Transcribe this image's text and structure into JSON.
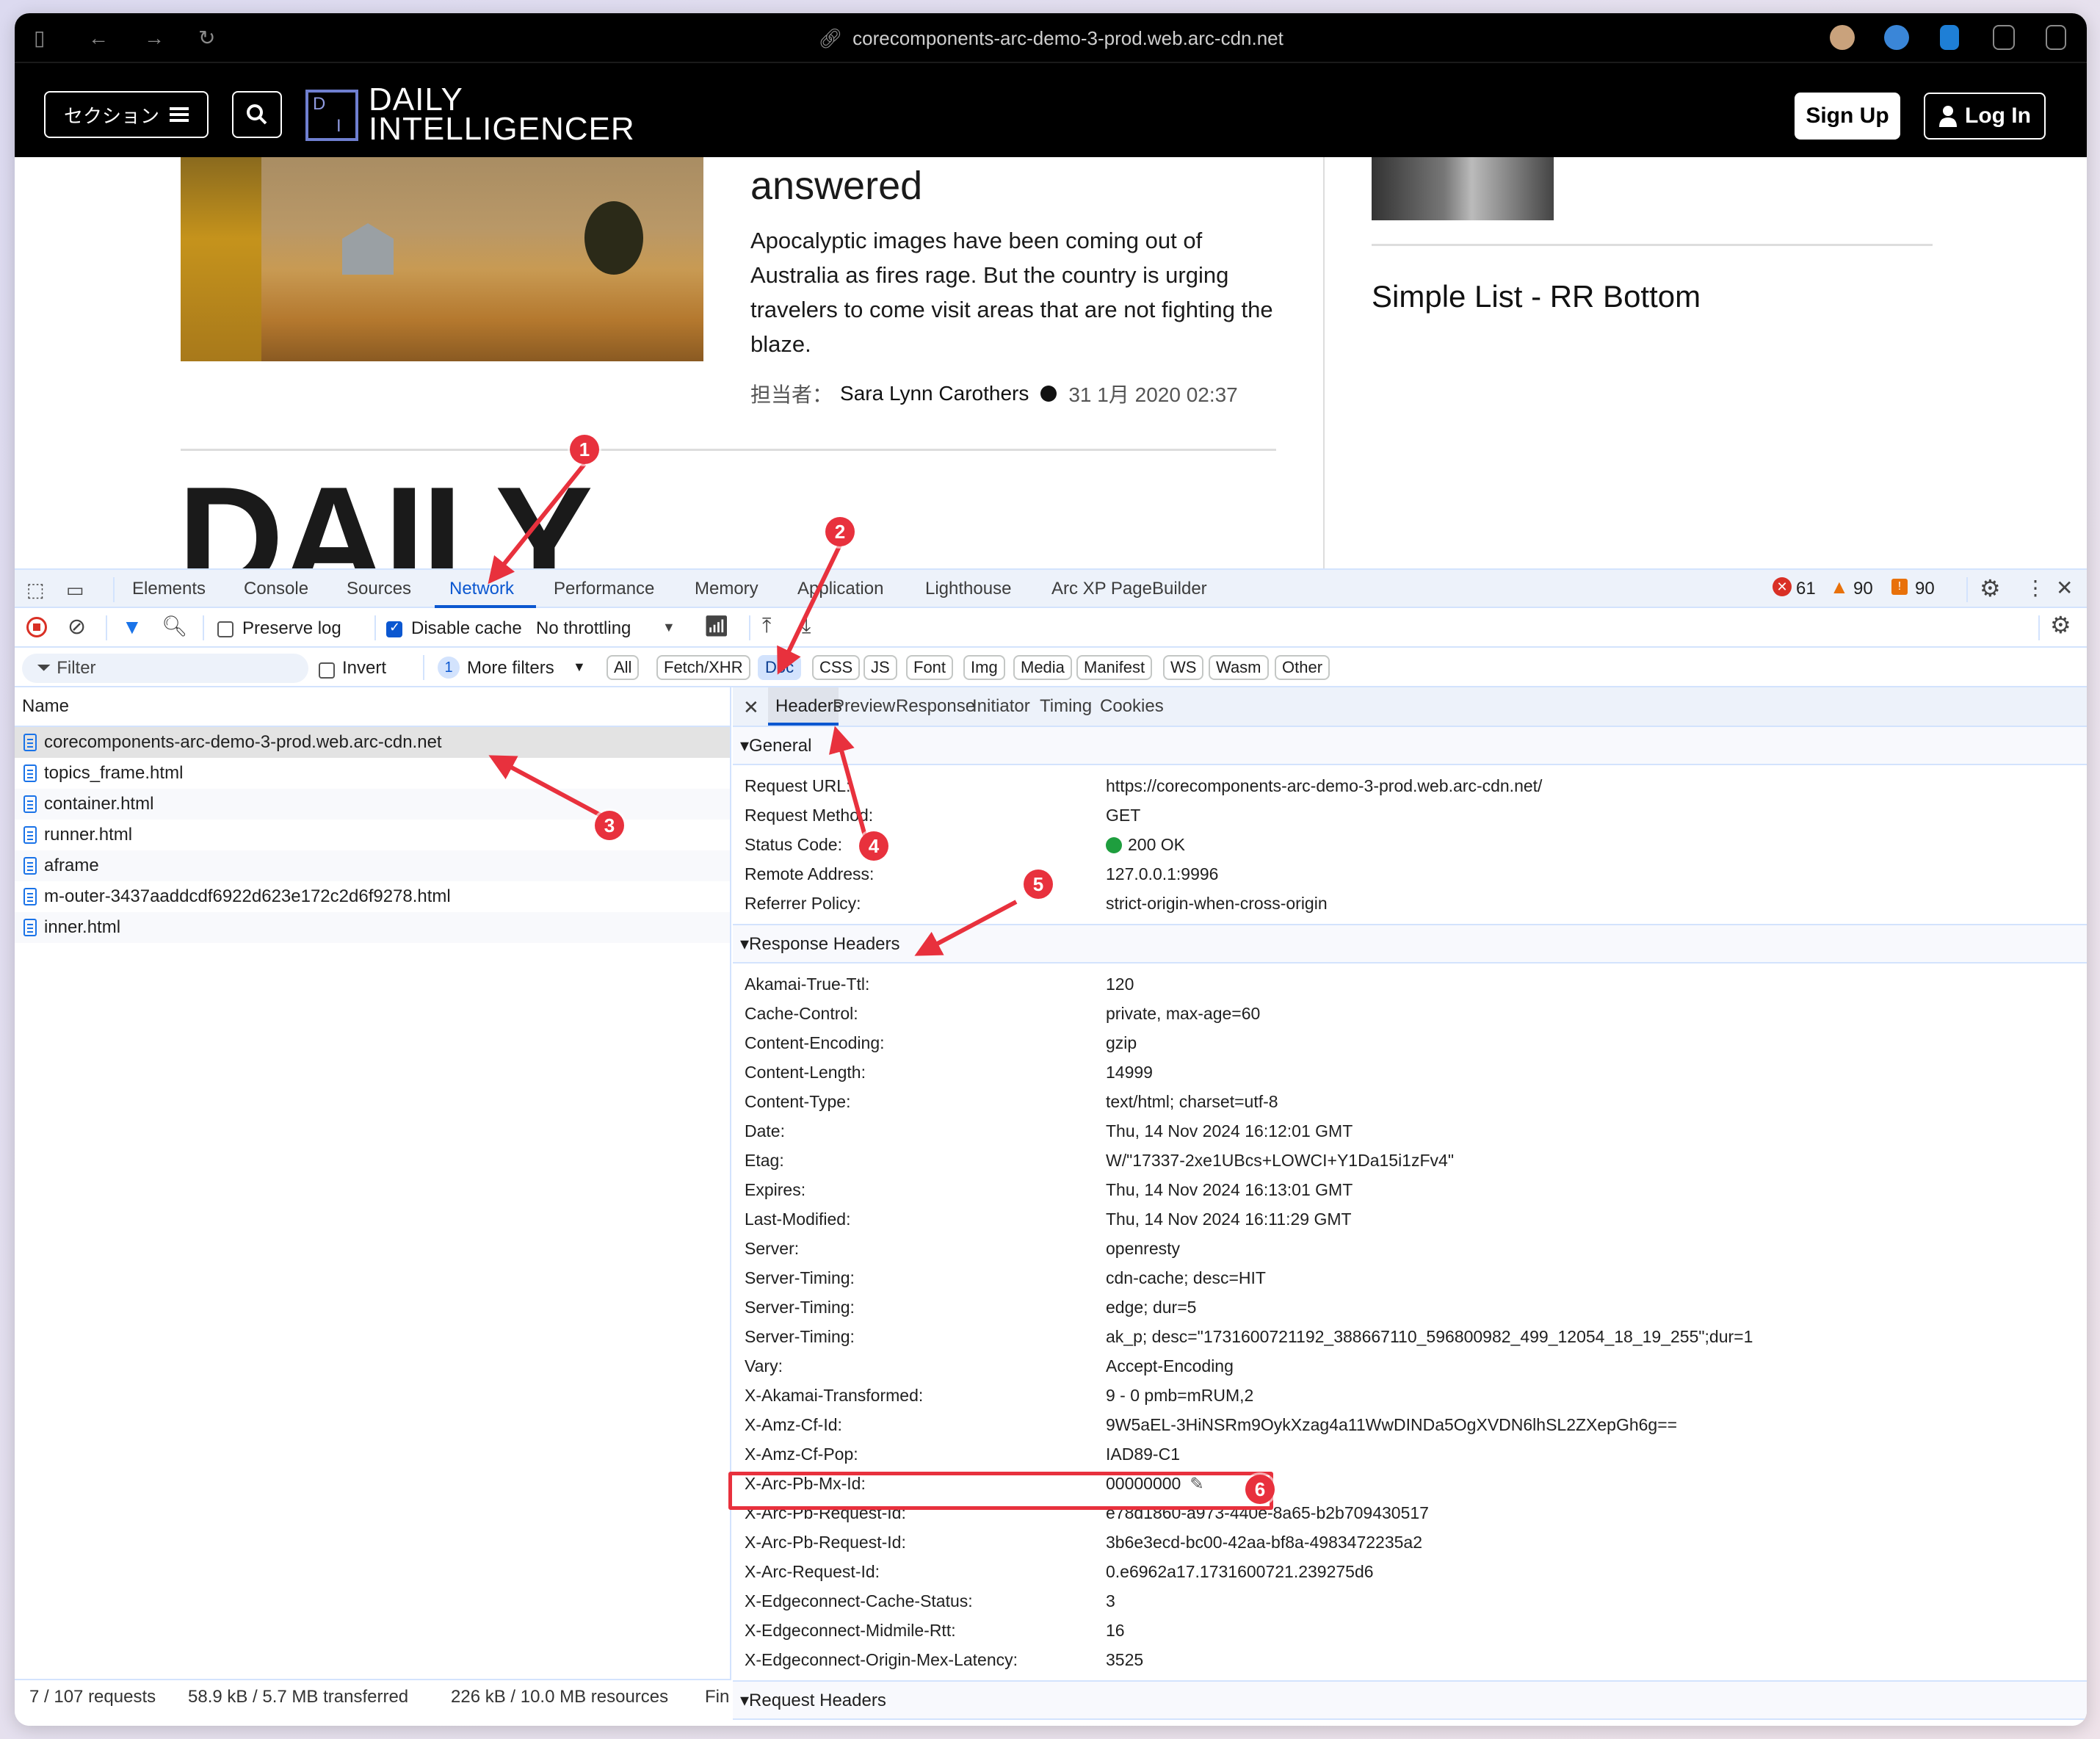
{
  "browser": {
    "url": "corecomponents-arc-demo-3-prod.web.arc-cdn.net",
    "icons": [
      "sidebar-toggle-icon",
      "back-icon",
      "forward-icon",
      "reload-icon",
      "link-icon",
      "extension-avatar-icon",
      "password-manager-icon",
      "extension-blue-icon",
      "extension-controls-icon",
      "split-view-icon"
    ]
  },
  "site": {
    "section_button": "セクション",
    "logo_letters": [
      "D",
      "I"
    ],
    "logo_line1": "DAILY",
    "logo_line2": "INTELLIGENCER",
    "sign_up": "Sign Up",
    "log_in": "Log In",
    "article": {
      "title_fragment": "answered",
      "description": "Apocalyptic images have been coming out of Australia as fires rage. But the country is urging travelers to come visit areas that are not fighting the blaze.",
      "byline_label": "担当者：",
      "author": "Sara Lynn Carothers",
      "date": "31 1月 2020 02:37"
    },
    "big_logo_text": "DAILY",
    "rr_title": "Simple List - RR Bottom"
  },
  "devtools": {
    "tabs": [
      "Elements",
      "Console",
      "Sources",
      "Network",
      "Performance",
      "Memory",
      "Application",
      "Lighthouse",
      "Arc XP PageBuilder"
    ],
    "active_tab": "Network",
    "counts": {
      "errors": "61",
      "warnings": "90",
      "issues": "90"
    },
    "colors": {
      "accent": "#0b57d0",
      "error": "#d93025",
      "warning": "#e8710a",
      "annotation": "#e8313d",
      "status_ok": "#1e9e3e"
    },
    "toolbar": {
      "preserve_log": "Preserve log",
      "preserve_log_checked": false,
      "disable_cache": "Disable cache",
      "disable_cache_checked": true,
      "throttling": "No throttling"
    },
    "filter_bar": {
      "filter_placeholder": "Filter",
      "invert": "Invert",
      "more_filters_count": "1",
      "more_filters": "More filters",
      "types": [
        "All",
        "Fetch/XHR",
        "Doc",
        "CSS",
        "JS",
        "Font",
        "Img",
        "Media",
        "Manifest",
        "WS",
        "Wasm",
        "Other"
      ],
      "active_type": "Doc"
    },
    "requests": {
      "column_name": "Name",
      "items": [
        "corecomponents-arc-demo-3-prod.web.arc-cdn.net",
        "topics_frame.html",
        "container.html",
        "runner.html",
        "aframe",
        "m-outer-3437aaddcdf6922d623e172c2d6f9278.html",
        "inner.html"
      ],
      "selected_index": 0
    },
    "status_bar": {
      "requests": "7 / 107 requests",
      "transferred": "58.9 kB / 5.7 MB transferred",
      "resources": "226 kB / 10.0 MB resources",
      "finish": "Fin"
    },
    "detail": {
      "close": "✕",
      "tabs": [
        "Headers",
        "Preview",
        "Response",
        "Initiator",
        "Timing",
        "Cookies"
      ],
      "active_tab": "Headers",
      "general_title": "General",
      "general": [
        {
          "k": "Request URL:",
          "v": "https://corecomponents-arc-demo-3-prod.web.arc-cdn.net/"
        },
        {
          "k": "Request Method:",
          "v": "GET"
        },
        {
          "k": "Status Code:",
          "v": "200 OK"
        },
        {
          "k": "Remote Address:",
          "v": "127.0.0.1:9996"
        },
        {
          "k": "Referrer Policy:",
          "v": "strict-origin-when-cross-origin"
        }
      ],
      "response_title": "Response Headers",
      "response": [
        {
          "k": "Akamai-True-Ttl:",
          "v": "120"
        },
        {
          "k": "Cache-Control:",
          "v": "private, max-age=60"
        },
        {
          "k": "Content-Encoding:",
          "v": "gzip"
        },
        {
          "k": "Content-Length:",
          "v": "14999"
        },
        {
          "k": "Content-Type:",
          "v": "text/html; charset=utf-8"
        },
        {
          "k": "Date:",
          "v": "Thu, 14 Nov 2024 16:12:01 GMT"
        },
        {
          "k": "Etag:",
          "v": "W/\"17337-2xe1UBcs+LOWCI+Y1Da15i1zFv4\""
        },
        {
          "k": "Expires:",
          "v": "Thu, 14 Nov 2024 16:13:01 GMT"
        },
        {
          "k": "Last-Modified:",
          "v": "Thu, 14 Nov 2024 16:11:29 GMT"
        },
        {
          "k": "Server:",
          "v": "openresty"
        },
        {
          "k": "Server-Timing:",
          "v": "cdn-cache; desc=HIT"
        },
        {
          "k": "Server-Timing:",
          "v": "edge; dur=5"
        },
        {
          "k": "Server-Timing:",
          "v": "ak_p; desc=\"1731600721192_388667110_596800982_499_12054_18_19_255\";dur=1"
        },
        {
          "k": "Vary:",
          "v": "Accept-Encoding"
        },
        {
          "k": "X-Akamai-Transformed:",
          "v": "9 - 0 pmb=mRUM,2"
        },
        {
          "k": "X-Amz-Cf-Id:",
          "v": "9W5aEL-3HiNSRm9OykXzag4a11WwDINDa5OgXVDN6lhSL2ZXepGh6g=="
        },
        {
          "k": "X-Amz-Cf-Pop:",
          "v": "IAD89-C1"
        },
        {
          "k": "X-Arc-Pb-Mx-Id:",
          "v": "00000000"
        },
        {
          "k": "X-Arc-Pb-Request-Id:",
          "v": "e78d1860-a973-440e-8a65-b2b709430517"
        },
        {
          "k": "X-Arc-Pb-Request-Id:",
          "v": "3b6e3ecd-bc00-42aa-bf8a-4983472235a2"
        },
        {
          "k": "X-Arc-Request-Id:",
          "v": "0.e6962a17.1731600721.239275d6"
        },
        {
          "k": "X-Edgeconnect-Cache-Status:",
          "v": "3"
        },
        {
          "k": "X-Edgeconnect-Midmile-Rtt:",
          "v": "16"
        },
        {
          "k": "X-Edgeconnect-Origin-Mex-Latency:",
          "v": "3525"
        }
      ],
      "request_title": "Request Headers"
    }
  },
  "annotations": [
    "1",
    "2",
    "3",
    "4",
    "5",
    "6"
  ]
}
